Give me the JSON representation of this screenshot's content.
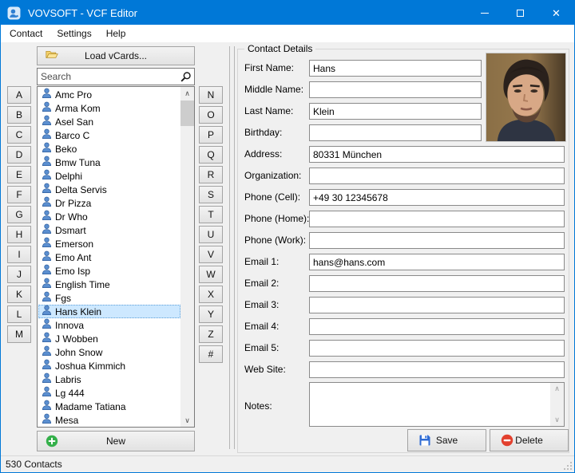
{
  "window": {
    "title": "VOVSOFT - VCF Editor"
  },
  "titlebar": {
    "controls": [
      "minimize",
      "maximize",
      "close"
    ]
  },
  "menu": {
    "items": [
      "Contact",
      "Settings",
      "Help"
    ]
  },
  "left_panel": {
    "load_button": "Load vCards...",
    "search_placeholder": "Search",
    "alphabet_left": [
      "A",
      "B",
      "C",
      "D",
      "E",
      "F",
      "G",
      "H",
      "I",
      "J",
      "K",
      "L",
      "M"
    ],
    "alphabet_right": [
      "N",
      "O",
      "P",
      "Q",
      "R",
      "S",
      "T",
      "U",
      "V",
      "W",
      "X",
      "Y",
      "Z",
      "#"
    ],
    "contacts": [
      "Amc Pro",
      "Arma Kom",
      "Asel San",
      "Barco C",
      "Beko",
      "Bmw Tuna",
      "Delphi",
      "Delta Servis",
      "Dr Pizza",
      "Dr Who",
      "Dsmart",
      "Emerson",
      "Emo Ant",
      "Emo Isp",
      "English Time",
      "Fgs",
      "Hans Klein",
      "Innova",
      "J Wobben",
      "John Snow",
      "Joshua Kimmich",
      "Labris",
      "Lg 444",
      "Madame Tatiana",
      "Mesa"
    ],
    "selected_contact": "Hans Klein",
    "new_button": "New"
  },
  "details": {
    "group_title": "Contact Details",
    "fields": [
      {
        "label": "First Name:",
        "value": "Hans",
        "size": "narrow"
      },
      {
        "label": "Middle Name:",
        "value": "",
        "size": "narrow"
      },
      {
        "label": "Last Name:",
        "value": "Klein",
        "size": "narrow"
      },
      {
        "label": "Birthday:",
        "value": "",
        "size": "narrow"
      },
      {
        "label": "Address:",
        "value": "80331 München",
        "size": "wide"
      },
      {
        "label": "Organization:",
        "value": "",
        "size": "wide"
      },
      {
        "label": "Phone (Cell):",
        "value": "+49 30 12345678",
        "size": "wide"
      },
      {
        "label": "Phone (Home):",
        "value": "",
        "size": "wide"
      },
      {
        "label": "Phone (Work):",
        "value": "",
        "size": "wide"
      },
      {
        "label": "Email 1:",
        "value": "hans@hans.com",
        "size": "wide"
      },
      {
        "label": "Email 2:",
        "value": "",
        "size": "wide"
      },
      {
        "label": "Email 3:",
        "value": "",
        "size": "wide"
      },
      {
        "label": "Email 4:",
        "value": "",
        "size": "wide"
      },
      {
        "label": "Email 5:",
        "value": "",
        "size": "wide"
      },
      {
        "label": "Web Site:",
        "value": "",
        "size": "wide"
      }
    ],
    "notes_label": "Notes:",
    "notes_value": "",
    "photo_alt": "contact-photo",
    "save_button": "Save",
    "delete_button": "Delete"
  },
  "status_bar": {
    "text": "530 Contacts"
  },
  "icons": [
    "contact-app-icon",
    "minimize-icon",
    "maximize-icon",
    "close-icon",
    "open-folder-icon",
    "search-icon",
    "person-icon",
    "plus-icon",
    "save-floppy-icon",
    "delete-icon",
    "scroll-up-icon",
    "scroll-down-icon"
  ],
  "colors": {
    "titlebar": "#0078d7",
    "selection_bg": "#cde8ff",
    "selection_border": "#5c9fd8",
    "new_green": "#34b04a",
    "delete_red": "#e2402e",
    "save_blue": "#2e6bd4",
    "folder_yellow": "#f6d26a"
  }
}
